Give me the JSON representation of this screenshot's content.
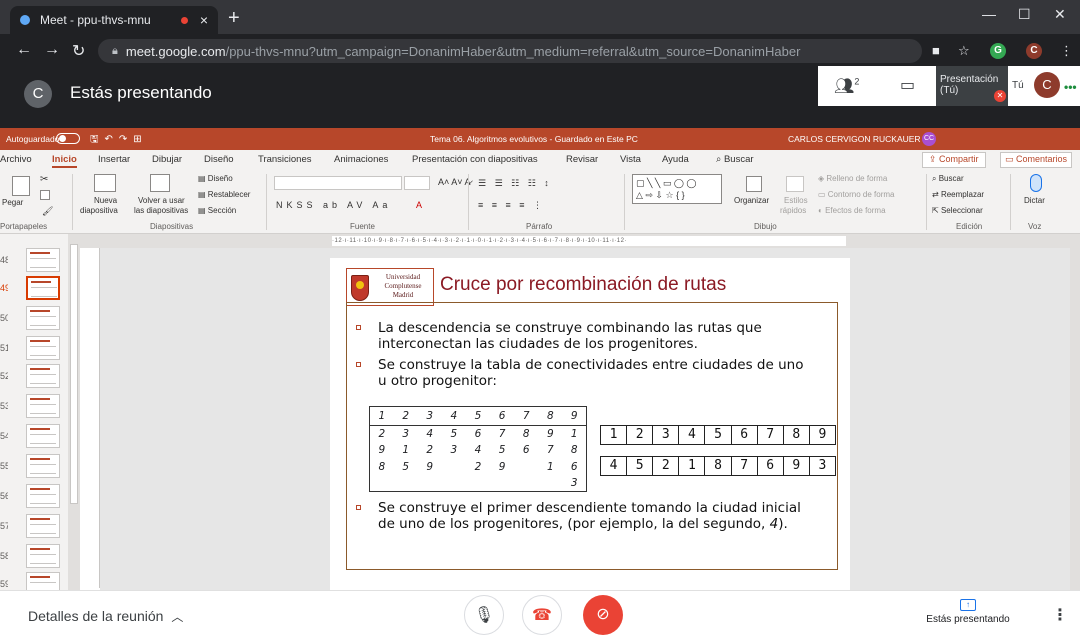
{
  "browser": {
    "tab_title": "Meet - ppu-thvs-mnu",
    "new_tab": "+",
    "close_tab": "×",
    "url_host": "meet.google.com",
    "url_path": "/ppu-thvs-mnu?utm_campaign=DonanimHaber&utm_medium=referral&utm_source=DonanimHaber",
    "profile_initial": "C",
    "ext_initial": "G"
  },
  "meet": {
    "title": "Estás presentando",
    "user_initial": "C",
    "people_count": "2",
    "presentation_label": "Presentación",
    "presentation_you": "(Tú)",
    "self_label": "Tú",
    "self_initial": "C",
    "details": "Detalles de la reunión",
    "presenting": "Estás presentando"
  },
  "ppt": {
    "autosave": "Autoguardado",
    "doc_title": "Tema 06. Algoritmos evolutivos - Guardado en Este PC",
    "user_name": "CARLOS CERVIGON RUCKAUER",
    "user_initials": "CC",
    "tabs": [
      "Archivo",
      "Inicio",
      "Insertar",
      "Dibujar",
      "Diseño",
      "Transiciones",
      "Animaciones",
      "Presentación con diapositivas",
      "Revisar",
      "Vista",
      "Ayuda",
      "Buscar"
    ],
    "share": "Compartir",
    "comments": "Comentarios",
    "ribbon": {
      "pegar": "Pegar",
      "nueva": "Nueva",
      "nueva2": "diapositiva",
      "volver": "Volver a usar",
      "volver2": "las diapositivas",
      "diseno": "Diseño",
      "restablecer": "Restablecer",
      "seccion": "Sección",
      "organizar": "Organizar",
      "estilos": "Estilos",
      "estilos2": "rápidos",
      "relleno": "Relleno de forma",
      "contorno": "Contorno de forma",
      "efectos": "Efectos de forma",
      "buscar": "Buscar",
      "reemplazar": "Reemplazar",
      "seleccionar": "Seleccionar",
      "dictar": "Dictar"
    },
    "groups": [
      "Portapapeles",
      "Diapositivas",
      "Fuente",
      "Párrafo",
      "Dibujo",
      "Edición",
      "Voz"
    ],
    "ruler": "·12·ı·11·ı·10·ı·9·ı·8·ı·7·ı·6·ı·5·ı·4·ı·3·ı·2·ı·1·ı·0·ı·1·ı·2·ı·3·ı·4·ı·5·ı·6·ı·7·ı·8·ı·9·ı·10·ı·11·ı·12·",
    "thumb_numbers": [
      "48",
      "49",
      "50",
      "51",
      "52",
      "53",
      "54",
      "55",
      "56",
      "57",
      "58",
      "59"
    ]
  },
  "slide": {
    "logo_line1": "Universidad",
    "logo_line2": "Complutense",
    "logo_line3": "Madrid",
    "title": "Cruce por recombinación de rutas",
    "bullet1": "La descendencia se construye combinando las rutas que interconectan las ciudades de los progenitores.",
    "bullet2": "Se construye la tabla de conectividades entre ciudades de uno u otro progenitor:",
    "bullet3_a": "Se construye el primer descendiente tomando la ciudad inicial de uno de los progenitores, (por ejemplo, la del segundo, ",
    "bullet3_em": "4",
    "bullet3_b": ").",
    "table_header": [
      "1",
      "2",
      "3",
      "4",
      "5",
      "6",
      "7",
      "8",
      "9"
    ],
    "table_rows": [
      [
        "2",
        "3",
        "4",
        "5",
        "6",
        "7",
        "8",
        "9",
        "1"
      ],
      [
        "9",
        "1",
        "2",
        "3",
        "4",
        "5",
        "6",
        "7",
        "8"
      ],
      [
        "8",
        "5",
        "9",
        "",
        "2",
        "9",
        "",
        "1",
        "6"
      ],
      [
        "",
        "",
        "",
        "",
        "",
        "",
        "",
        "",
        "3"
      ]
    ],
    "parent1": [
      "1",
      "2",
      "3",
      "4",
      "5",
      "6",
      "7",
      "8",
      "9"
    ],
    "parent2": [
      "4",
      "5",
      "2",
      "1",
      "8",
      "7",
      "6",
      "9",
      "3"
    ]
  }
}
